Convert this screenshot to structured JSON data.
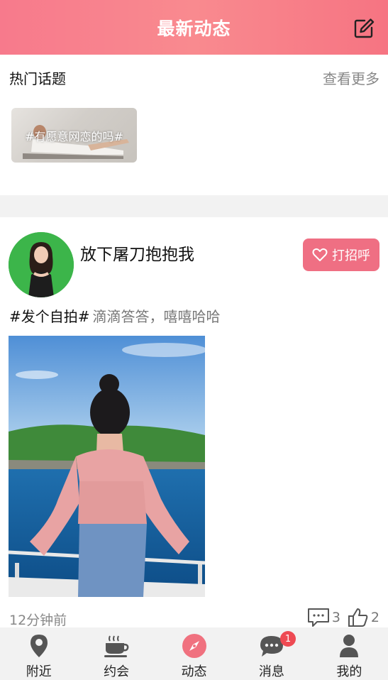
{
  "header": {
    "title": "最新动态",
    "edit_icon": "edit-icon"
  },
  "topics": {
    "title": "热门话题",
    "more": "查看更多",
    "items": [
      {
        "label": "#有愿意网恋的吗#"
      }
    ]
  },
  "post": {
    "username": "放下屠刀抱抱我",
    "greet_label": "打招呼",
    "tag": "#发个自拍#",
    "body": "滴滴答答，嘻嘻哈哈",
    "time": "12分钟前",
    "comments": "3",
    "likes": "2"
  },
  "nav": {
    "items": [
      {
        "label": "附近",
        "icon": "location-pin-icon"
      },
      {
        "label": "约会",
        "icon": "coffee-cup-icon"
      },
      {
        "label": "动态",
        "icon": "compass-icon"
      },
      {
        "label": "消息",
        "icon": "chat-bubble-icon"
      },
      {
        "label": "我的",
        "icon": "user-icon"
      }
    ],
    "message_badge": "1"
  },
  "colors": {
    "accent": "#f67e8c",
    "greet": "#ef6f83",
    "badge": "#ee4a53"
  }
}
